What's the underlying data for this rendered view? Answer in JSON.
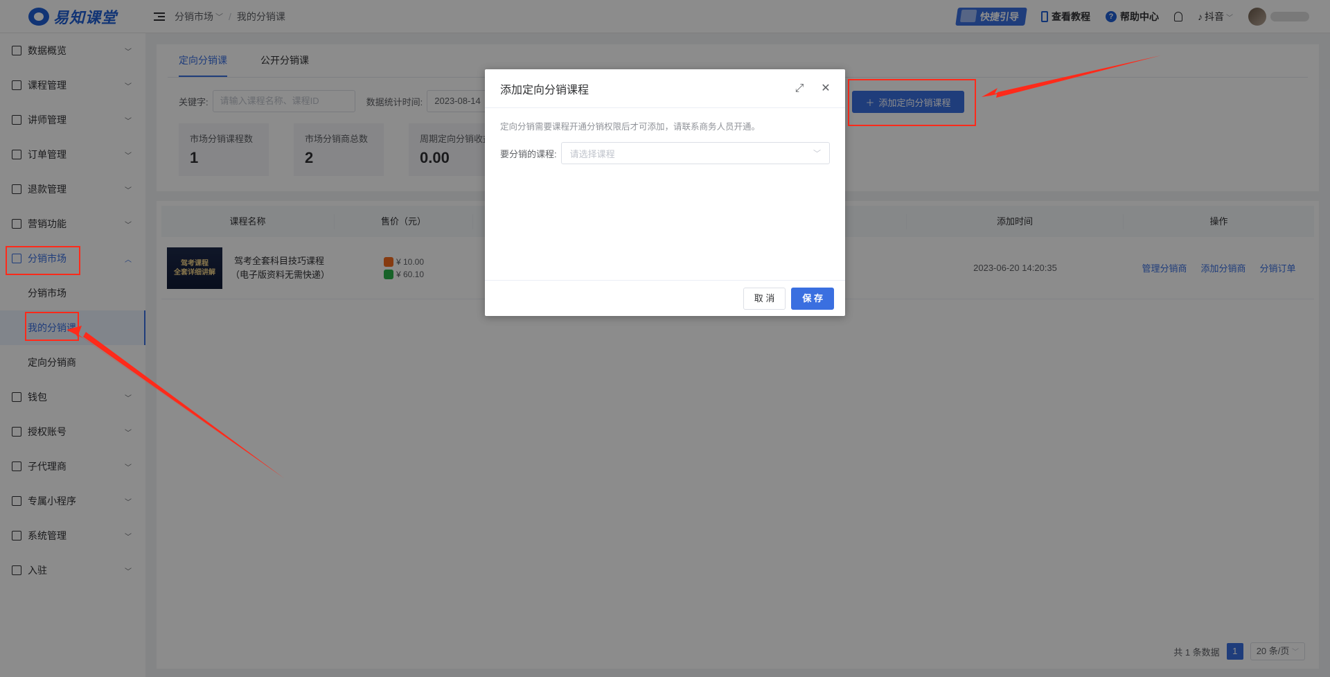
{
  "header": {
    "logo_text": "易知课堂",
    "breadcrumb": [
      "分销市场",
      "我的分销课"
    ],
    "quick_guide": "快捷引导",
    "tutorial": "查看教程",
    "help": "帮助中心",
    "platform": "抖音"
  },
  "sidebar": {
    "items": [
      {
        "label": "数据概览",
        "icon": "home-icon"
      },
      {
        "label": "课程管理",
        "icon": "grid-icon"
      },
      {
        "label": "讲师管理",
        "icon": "teacher-icon"
      },
      {
        "label": "订单管理",
        "icon": "order-icon"
      },
      {
        "label": "退款管理",
        "icon": "refund-icon"
      },
      {
        "label": "营销功能",
        "icon": "bag-icon"
      },
      {
        "label": "分销市场",
        "icon": "shop-icon"
      },
      {
        "label": "钱包",
        "icon": "wallet-icon"
      },
      {
        "label": "授权账号",
        "icon": "tiktok-icon"
      },
      {
        "label": "子代理商",
        "icon": "agent-icon"
      },
      {
        "label": "专属小程序",
        "icon": "miniapp-icon"
      },
      {
        "label": "系统管理",
        "icon": "gear-icon"
      },
      {
        "label": "入驻",
        "icon": "settle-icon"
      }
    ],
    "sub_items": [
      "分销市场",
      "我的分销课",
      "定向分销商"
    ]
  },
  "tabs": [
    "定向分销课",
    "公开分销课"
  ],
  "filters": {
    "keyword_label": "关键字:",
    "keyword_placeholder": "请输入课程名称、课程ID",
    "date_label": "数据统计时间:",
    "date_value": "2023-08-14"
  },
  "add_button": "添加定向分销课程",
  "stats": [
    {
      "label": "市场分销课程数",
      "value": "1"
    },
    {
      "label": "市场分销商总数",
      "value": "2"
    },
    {
      "label": "周期定向分销收益",
      "value": "0.00"
    }
  ],
  "table": {
    "headers": [
      "课程名称",
      "售价（元）",
      "添加时间",
      "操作"
    ],
    "rows": [
      {
        "thumb_lines": [
          "驾考课程",
          "全套详细讲解"
        ],
        "name": "驾考全套科目技巧课程（电子版资料无需快递）",
        "price_douyin": "¥ 10.00",
        "price_wechat": "¥ 60.10",
        "added": "2023-06-20 14:20:35",
        "ops": [
          "管理分销商",
          "添加分销商",
          "分销订单"
        ]
      }
    ]
  },
  "pagination": {
    "total": "共 1 条数据",
    "page": "1",
    "page_size": "20 条/页"
  },
  "dialog": {
    "title": "添加定向分销课程",
    "tip": "定向分销需要课程开通分销权限后才可添加，请联系商务人员开通。",
    "field_label": "要分销的课程:",
    "field_placeholder": "请选择课程",
    "cancel": "取 消",
    "save": "保 存"
  },
  "colors": {
    "accent": "#3a6fe0",
    "annotation": "#ff2a1a"
  }
}
